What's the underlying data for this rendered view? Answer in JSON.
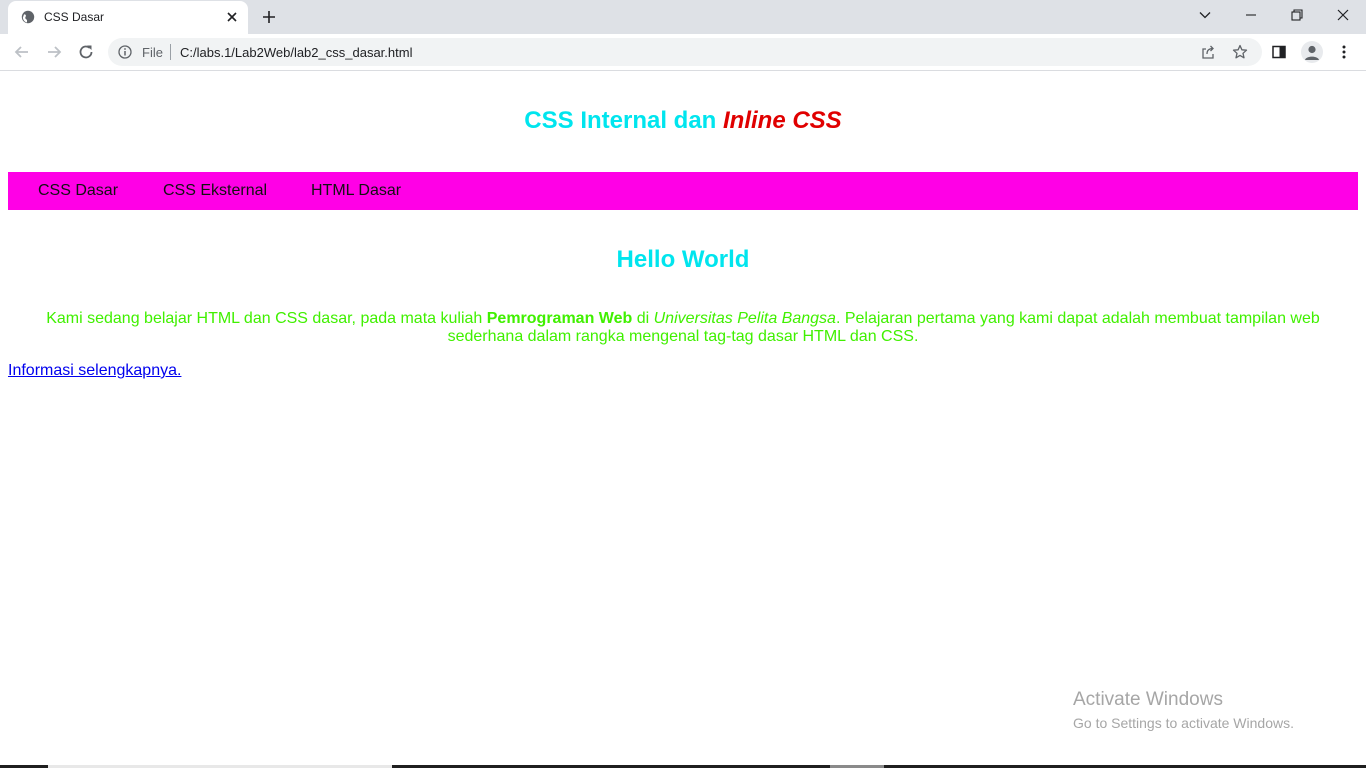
{
  "browser": {
    "tab": {
      "title": "CSS Dasar",
      "favicon": "globe-icon",
      "close_icon": "close-icon"
    },
    "new_tab_icon": "plus-icon",
    "window_controls": [
      "chevron-down-icon",
      "minimize-icon",
      "restore-icon",
      "close-icon"
    ],
    "toolbar": {
      "back_icon": "arrow-left-icon",
      "forward_icon": "arrow-right-icon",
      "reload_icon": "reload-icon",
      "scheme_label": "File",
      "url": "C:/labs.1/Lab2Web/lab2_css_dasar.html",
      "share_icon": "share-icon",
      "bookmark_icon": "star-icon",
      "side_panel_icon": "side-panel-icon",
      "profile_icon": "avatar-icon",
      "menu_icon": "kebab-menu-icon"
    }
  },
  "page": {
    "header": {
      "title_plain": "CSS Internal dan ",
      "title_inline": "Inline CSS"
    },
    "nav": [
      "CSS Dasar",
      "CSS Eksternal",
      "HTML Dasar"
    ],
    "hello": "Hello World",
    "intro": {
      "part1": "Kami sedang belajar HTML dan CSS dasar, pada mata kuliah ",
      "bold": "Pemrograman Web",
      "part2": " di ",
      "italic": "Universitas Pelita Bangsa",
      "part3": ". Pelajaran pertama yang kami dapat adalah membuat tampilan web sederhana dalam rangka mengenal tag-tag dasar HTML dan CSS."
    },
    "more_link": "Informasi selengkapnya."
  },
  "watermark": {
    "title": "Activate Windows",
    "subtitle": "Go to Settings to activate Windows."
  },
  "colors": {
    "heading": "#00e5ee",
    "inline_css": "#e00000",
    "nav_background": "#ff00e6",
    "paragraph": "#40f000",
    "link": "#0000ee"
  }
}
